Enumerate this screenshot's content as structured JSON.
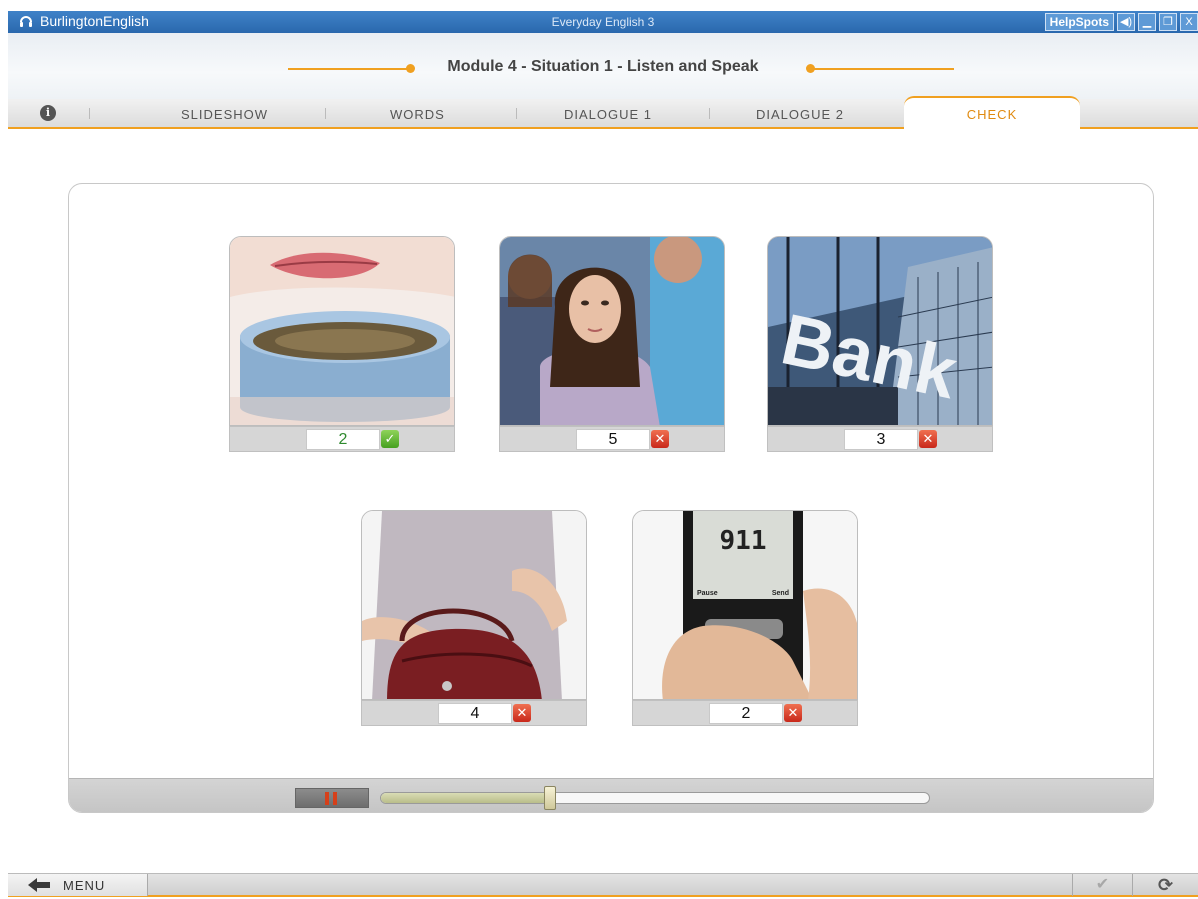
{
  "window": {
    "brand": "BurlingtonEnglish",
    "title": "Everyday English 3",
    "helpspots_label": "HelpSpots",
    "buttons": [
      "sound",
      "minimize",
      "restore",
      "close"
    ]
  },
  "module": {
    "title": "Module 4 - Situation 1 - Listen and Speak"
  },
  "tabs": [
    {
      "label": "SLIDESHOW",
      "active": false
    },
    {
      "label": "WORDS",
      "active": false
    },
    {
      "label": "DIALOGUE 1",
      "active": false
    },
    {
      "label": "DIALOGUE 2",
      "active": false
    },
    {
      "label": "CHECK",
      "active": true
    }
  ],
  "cards": [
    {
      "image": "woman-drinking-from-cup",
      "answer": "2",
      "result": "correct"
    },
    {
      "image": "crowd-of-people",
      "answer": "5",
      "result": "wrong"
    },
    {
      "image": "bank-building",
      "answer": "3",
      "result": "wrong"
    },
    {
      "image": "woman-opening-handbag",
      "answer": "4",
      "result": "wrong"
    },
    {
      "image": "phone-dialing-911",
      "answer": "2",
      "result": "wrong",
      "phone_screen_text": "911",
      "phone_left_key": "Pause",
      "phone_right_key": "Send"
    }
  ],
  "media": {
    "state": "playing",
    "progress": 0.31
  },
  "footer": {
    "menu_label": "MENU",
    "check_icon": "check-icon",
    "refresh_icon": "refresh-icon"
  },
  "colors": {
    "accent": "#f0a020",
    "titlebar": "#2f6fb5",
    "correct": "#46a020",
    "wrong": "#c8281a"
  }
}
